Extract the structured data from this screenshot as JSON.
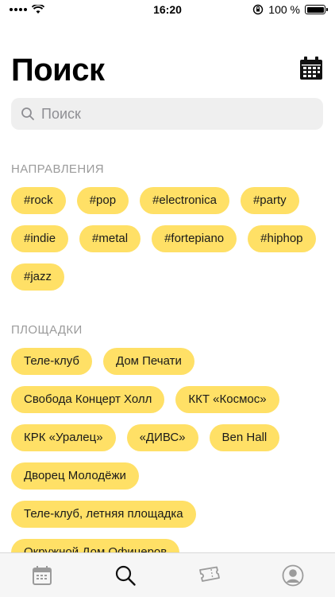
{
  "status_bar": {
    "time": "16:20",
    "battery": "100 %",
    "battery_level": 1.0
  },
  "header": {
    "title": "Поиск"
  },
  "search": {
    "placeholder": "Поиск",
    "value": ""
  },
  "genres": {
    "title": "НАПРАВЛЕНИЯ",
    "tags": [
      "#rock",
      "#pop",
      "#electronica",
      "#party",
      "#indie",
      "#metal",
      "#fortepiano",
      "#hiphop",
      "#jazz"
    ]
  },
  "venues": {
    "title": "ПЛОЩАДКИ",
    "tags": [
      "Теле-клуб",
      "Дом Печати",
      "Свобода Концерт Холл",
      "ККТ «Космос»",
      "КРК «Уралец»",
      "«ДИВС»",
      "Ben Hall",
      "Дворец Молодёжи",
      "Теле-клуб, летняя площадка",
      "Окружной Дом Офицеров"
    ]
  },
  "tab_bar": {
    "active": "search",
    "tabs": [
      "calendar-icon",
      "search-icon",
      "tickets-icon",
      "profile-icon"
    ]
  },
  "colors": {
    "tag": "#ffe066",
    "section_title": "#9b9b9b",
    "search_bg": "#efefef"
  }
}
